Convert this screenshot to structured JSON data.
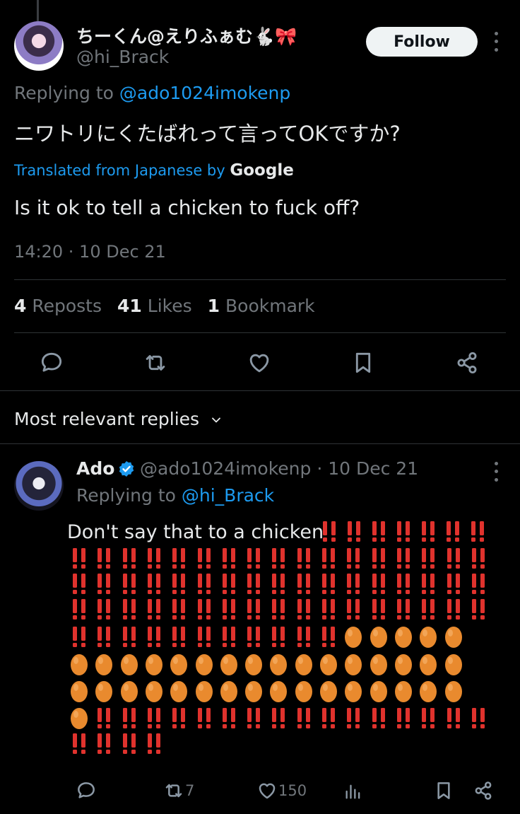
{
  "main_tweet": {
    "display_name": "ちーくん@えりふぁむ🐇🎀",
    "handle": "@hi_Brack",
    "follow_label": "Follow",
    "replying_prefix": "Replying to ",
    "replying_to": "@ado1024imokenp",
    "text": "ニワトリにくたばれって言ってOKですか?",
    "translated_label": "Translated from Japanese by ",
    "translated_by": "Google",
    "translation": "Is it ok to tell a chicken to fuck off?",
    "timestamp": "14:20 · 10 Dec 21",
    "reposts_count": "4",
    "reposts_label": "Reposts",
    "likes_count": "41",
    "likes_label": "Likes",
    "bookmarks_count": "1",
    "bookmarks_label": "Bookmark",
    "actions": [
      "reply-icon",
      "repost-icon",
      "like-icon",
      "bookmark-icon",
      "share-icon"
    ]
  },
  "replies_sort": {
    "label": "Most relevant replies"
  },
  "reply": {
    "display_name": "Ado",
    "handle_time": "@ado1024imokenp · 10 Dec 21",
    "replying_prefix": "Replying to ",
    "replying_to": "@hi_Brack",
    "text": "Don't say that to a chicken",
    "emoji_sequence": "7 bang | 17 bang | 17 bang | 17 bang | 11 bang + 5 egg | 16 egg | 16 egg | 1 egg + 16 bang | 4 bang",
    "reposts_count": "7",
    "likes_count": "150",
    "actions": [
      "reply-icon",
      "repost-icon",
      "like-icon",
      "views-icon",
      "bookmark-icon",
      "share-icon"
    ]
  },
  "colors": {
    "background": "#000000",
    "text_primary": "#e7e9ea",
    "text_secondary": "#71767b",
    "accent_blue": "#1d9bf0",
    "divider": "#2f3336",
    "bang_red": "#e0322d",
    "egg_orange": "#e98a2e"
  }
}
